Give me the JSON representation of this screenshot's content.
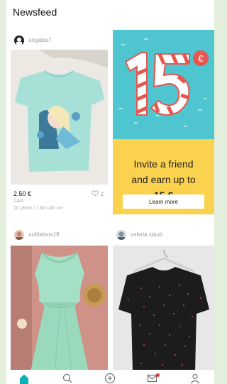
{
  "header": {
    "title": "Newsfeed"
  },
  "feed": {
    "item1": {
      "username": "angalas7",
      "price": "2.50 €",
      "likes": "2",
      "brand": "C&A",
      "details": "10 years / 134-140 cm"
    },
    "promo": {
      "badge": "15€",
      "line1": "Invite a friend",
      "line2": "and earn up to",
      "amount": "15 €",
      "button": "Learn more"
    },
    "item2": {
      "username": "aufdeloos18"
    },
    "item3": {
      "username": "valeria.staub"
    }
  },
  "nav": {
    "items": [
      {
        "icon": "home-icon",
        "active": true
      },
      {
        "icon": "search-icon"
      },
      {
        "icon": "add-icon"
      },
      {
        "icon": "inbox-icon",
        "badge": true
      },
      {
        "icon": "profile-icon"
      }
    ]
  },
  "colors": {
    "accent": "#0bb3b8",
    "promo_blue": "#4fc6cf",
    "promo_yellow": "#fbd24e",
    "notification": "#e53935"
  }
}
